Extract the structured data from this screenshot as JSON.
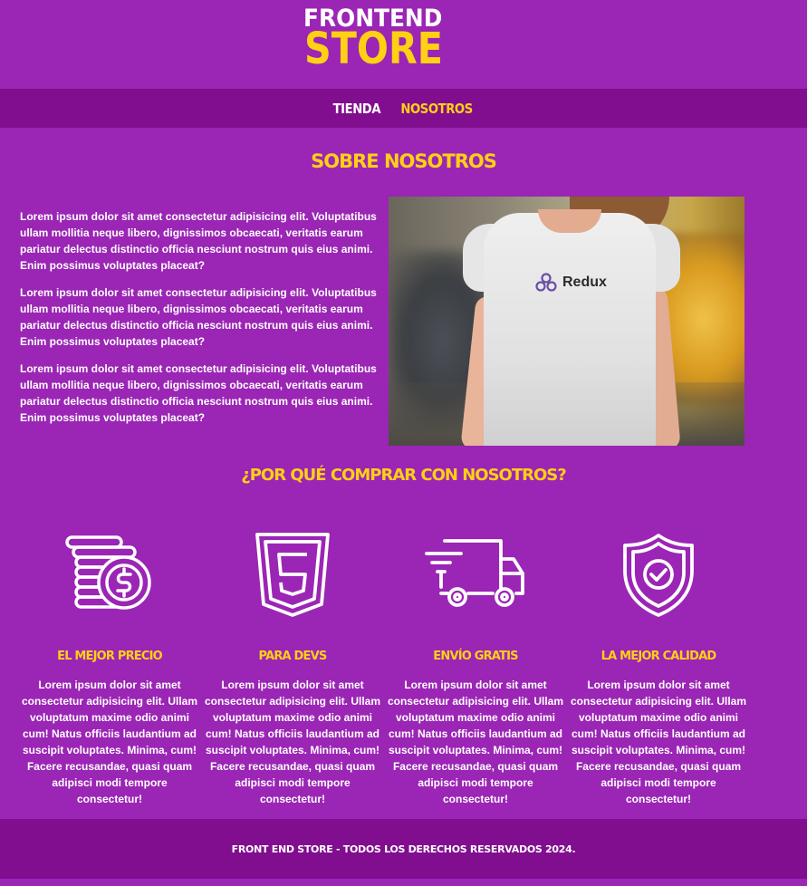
{
  "logo": {
    "line1": "FRONTEND",
    "line2": "STORE"
  },
  "nav": {
    "items": [
      {
        "label": "Tienda"
      },
      {
        "label": "Nosotros"
      }
    ]
  },
  "about": {
    "title": "Sobre Nosotros",
    "paragraphs": [
      "Lorem ipsum dolor sit amet consectetur adipisicing elit. Voluptatibus ullam mollitia neque libero, dignissimos obcaecati, veritatis earum pariatur delectus distinctio officia nesciunt nostrum quis eius animi. Enim possimus voluptates placeat?",
      "Lorem ipsum dolor sit amet consectetur adipisicing elit. Voluptatibus ullam mollitia neque libero, dignissimos obcaecati, veritatis earum pariatur delectus distinctio officia nesciunt nostrum quis eius animi. Enim possimus voluptates placeat?",
      "Lorem ipsum dolor sit amet consectetur adipisicing elit. Voluptatibus ullam mollitia neque libero, dignissimos obcaecati, veritatis earum pariatur delectus distinctio officia nesciunt nostrum quis eius animi. Enim possimus voluptates placeat?"
    ],
    "image": {
      "brand_text": "Redux"
    }
  },
  "why": {
    "title": "¿Por qué comprar con nosotros?",
    "features": [
      {
        "icon": "coins-dollar-icon",
        "title": "El mejor precio",
        "text": "Lorem ipsum dolor sit amet consectetur adipisicing elit. Ullam voluptatum maxime odio animi cum! Natus officiis laudantium ad suscipit voluptates. Minima, cum! Facere recusandae, quasi quam adipisci modi tempore consectetur!"
      },
      {
        "icon": "html5-icon",
        "title": "Para Devs",
        "text": "Lorem ipsum dolor sit amet consectetur adipisicing elit. Ullam voluptatum maxime odio animi cum! Natus officiis laudantium ad suscipit voluptates. Minima, cum! Facere recusandae, quasi quam adipisci modi tempore consectetur!"
      },
      {
        "icon": "delivery-truck-icon",
        "title": "Envío Gratis",
        "text": "Lorem ipsum dolor sit amet consectetur adipisicing elit. Ullam voluptatum maxime odio animi cum! Natus officiis laudantium ad suscipit voluptates. Minima, cum! Facere recusandae, quasi quam adipisci modi tempore consectetur!"
      },
      {
        "icon": "shield-check-icon",
        "title": "La mejor calidad",
        "text": "Lorem ipsum dolor sit amet consectetur adipisicing elit. Ullam voluptatum maxime odio animi cum! Natus officiis laudantium ad suscipit voluptates. Minima, cum! Facere recusandae, quasi quam adipisci modi tempore consectetur!"
      }
    ]
  },
  "footer": {
    "text": "Front End Store - Todos los derechos reservados 2024."
  },
  "colors": {
    "background": "#9b25b5",
    "dark_bar": "#810d8f",
    "accent": "#ffd014",
    "text": "#ffffff"
  }
}
